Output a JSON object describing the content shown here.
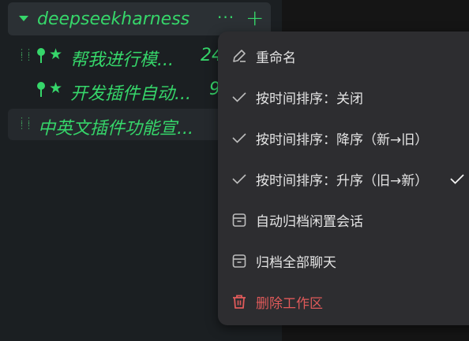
{
  "workspace": {
    "name": "deepseekharness",
    "more_label": "···",
    "add_label": "+"
  },
  "sessions": [
    {
      "title": "帮我进行模...",
      "count": "24"
    },
    {
      "title": "开发插件自动...",
      "count": "9"
    },
    {
      "title": "中英文插件功能宣..."
    }
  ],
  "menu": {
    "items": [
      {
        "label": "重命名",
        "icon": "pencil-icon"
      },
      {
        "label": "按时间排序：关闭",
        "icon": "check-icon"
      },
      {
        "label": "按时间排序：降序（新→旧）",
        "icon": "check-icon"
      },
      {
        "label": "按时间排序：升序（旧→新）",
        "icon": "check-icon",
        "selected": true
      },
      {
        "label": "自动归档闲置会话",
        "icon": "archive-icon"
      },
      {
        "label": "归档全部聊天",
        "icon": "archive-icon"
      },
      {
        "label": "删除工作区",
        "icon": "trash-icon",
        "danger": true
      }
    ]
  },
  "colors": {
    "accent": "#36d66a",
    "danger": "#e05a5a",
    "menu_bg": "#2d2d30",
    "sidebar_bg": "#1b1f22"
  }
}
